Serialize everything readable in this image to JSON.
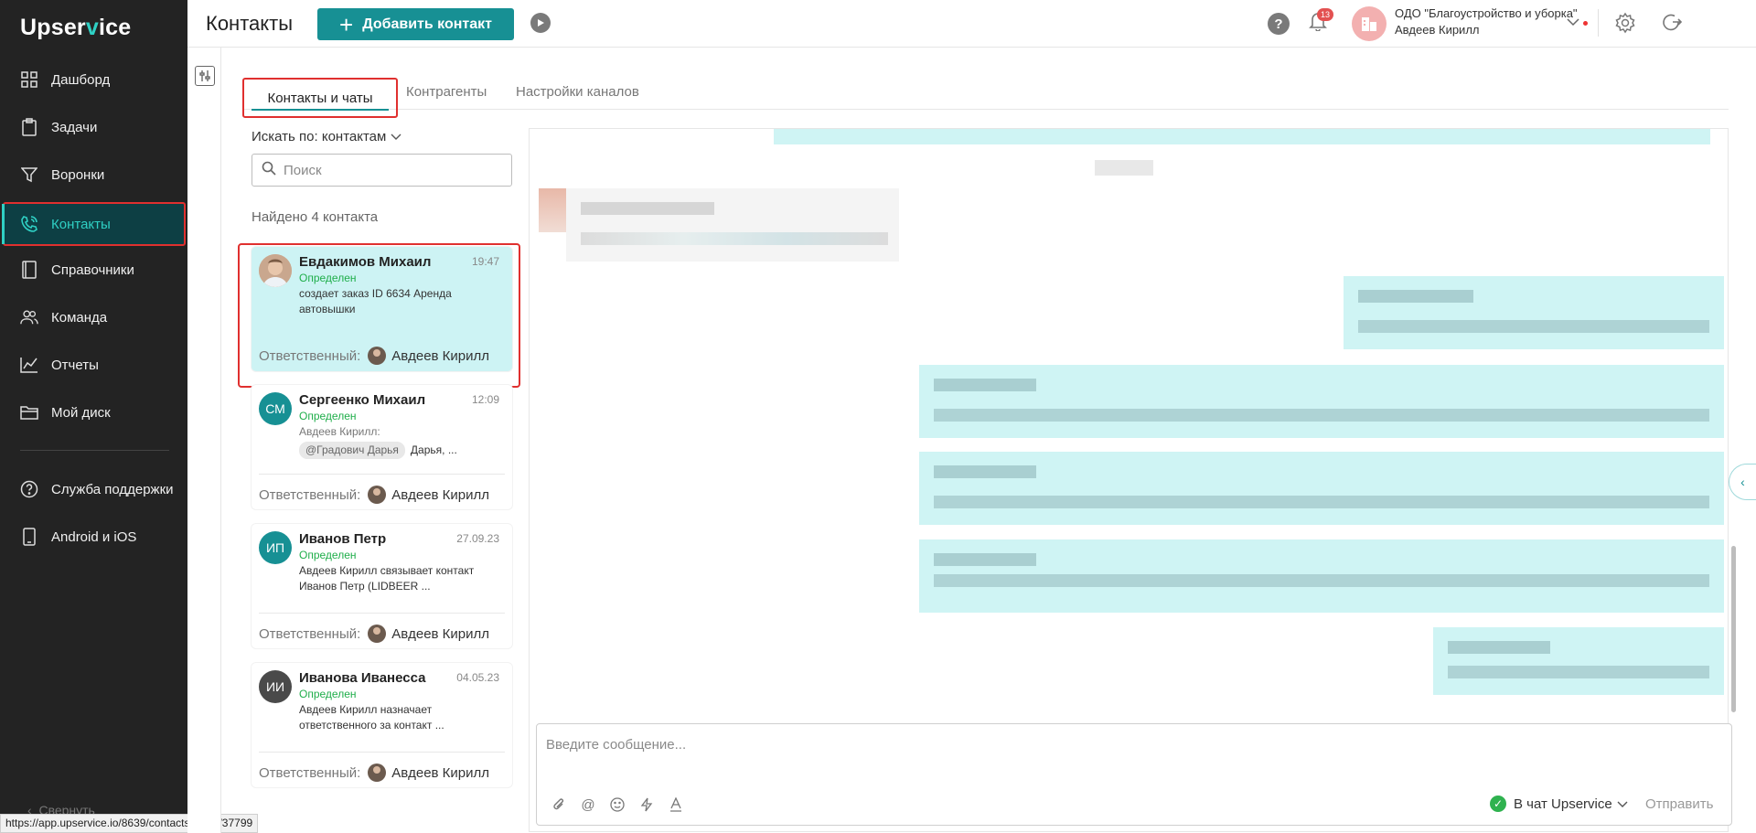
{
  "app": {
    "logo_prefix": "Upser",
    "logo_v": "v",
    "logo_suffix": "ice"
  },
  "sidebar": {
    "items": [
      {
        "label": "Дашборд",
        "icon": "grid-icon"
      },
      {
        "label": "Задачи",
        "icon": "clipboard-icon"
      },
      {
        "label": "Воронки",
        "icon": "funnel-icon"
      },
      {
        "label": "Контакты",
        "icon": "phone-icon"
      },
      {
        "label": "Справочники",
        "icon": "book-icon"
      },
      {
        "label": "Команда",
        "icon": "team-icon"
      },
      {
        "label": "Отчеты",
        "icon": "chart-line-icon"
      },
      {
        "label": "Мой диск",
        "icon": "folder-icon"
      },
      {
        "label": "Служба поддержки",
        "icon": "help-circle-icon"
      },
      {
        "label": "Android и iOS",
        "icon": "mobile-icon"
      }
    ],
    "collapse_label": "Свернуть"
  },
  "status_url": "https://app.upservice.io/8639/contacts/chats/37799",
  "header": {
    "title": "Контакты",
    "add_button": "Добавить контакт",
    "help": "?",
    "notifications_count": "13",
    "org_name": "ОДО \"Благоустройство и уборка\"",
    "user_name": "Авдеев Кирилл"
  },
  "tabs": [
    {
      "label": "Контакты и чаты"
    },
    {
      "label": "Контрагенты"
    },
    {
      "label": "Настройки каналов"
    }
  ],
  "search": {
    "search_by": "Искать по: контактам",
    "placeholder": "Поиск",
    "found": "Найдено 4 контакта"
  },
  "contacts": [
    {
      "name": "Евдакимов Михаил",
      "time": "19:47",
      "status": "Определен",
      "message": "создает заказ ID 6634 Аренда автовышки",
      "responsible_label": "Ответственный:",
      "responsible": "Авдеев Кирилл"
    },
    {
      "name": "Сергеенко Михаил",
      "initials": "СМ",
      "time": "12:09",
      "status": "Определен",
      "message_author": "Авдеев Кирилл:",
      "mention": "@Градович Дарья",
      "message": "Дарья, ...",
      "responsible_label": "Ответственный:",
      "responsible": "Авдеев Кирилл"
    },
    {
      "name": "Иванов Петр",
      "initials": "ИП",
      "time": "27.09.23",
      "status": "Определен",
      "message": "Авдеев Кирилл связывает контакт Иванов Петр (LIDBEER ...",
      "responsible_label": "Ответственный:",
      "responsible": "Авдеев Кирилл"
    },
    {
      "name": "Иванова Иванесса",
      "initials": "ИИ",
      "time": "04.05.23",
      "status": "Определен",
      "message": "Авдеев Кирилл назначает ответственного за контакт ...",
      "responsible_label": "Ответственный:",
      "responsible": "Авдеев Кирилл"
    }
  ],
  "composer": {
    "placeholder": "Введите сообщение...",
    "channel": "В чат Upservice",
    "send": "Отправить"
  },
  "colors": {
    "accent": "#179094",
    "highlight": "#e0302f",
    "bubble": "#cff4f4",
    "sidebar_bg": "#232323",
    "status_green": "#1fae4a"
  }
}
